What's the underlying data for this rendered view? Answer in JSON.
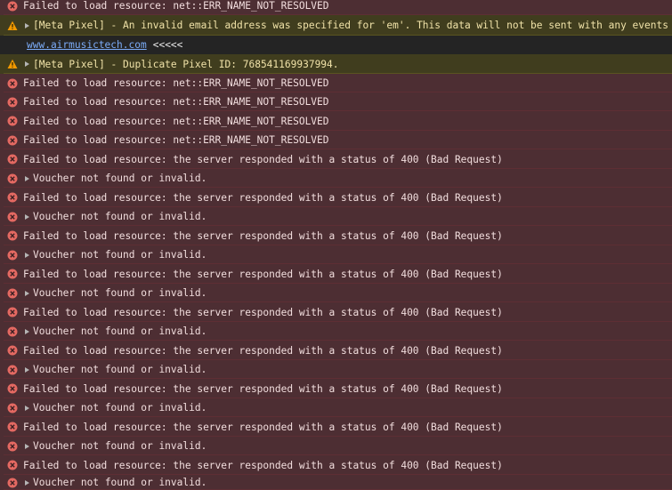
{
  "rows": [
    {
      "type": "error",
      "text": "Failed to load resource: net::ERR_NAME_NOT_RESOLVED",
      "expandable": false
    },
    {
      "type": "warning",
      "text": "[Meta Pixel] - An invalid email address was specified for 'em'. This data will not be sent with any events f",
      "expandable": true
    },
    {
      "type": "continuation",
      "link": "www.airmusictech.com",
      "tail": "<<<<<"
    },
    {
      "type": "warning",
      "text": "[Meta Pixel] - Duplicate Pixel ID: 768541169937994.",
      "expandable": true
    },
    {
      "type": "error",
      "text": "Failed to load resource: net::ERR_NAME_NOT_RESOLVED",
      "expandable": false
    },
    {
      "type": "error",
      "text": "Failed to load resource: net::ERR_NAME_NOT_RESOLVED",
      "expandable": false
    },
    {
      "type": "error",
      "text": "Failed to load resource: net::ERR_NAME_NOT_RESOLVED",
      "expandable": false
    },
    {
      "type": "error",
      "text": "Failed to load resource: net::ERR_NAME_NOT_RESOLVED",
      "expandable": false
    },
    {
      "type": "error",
      "text": "Failed to load resource: the server responded with a status of 400 (Bad Request)",
      "expandable": false
    },
    {
      "type": "error",
      "text": "Voucher not found or invalid.",
      "expandable": true
    },
    {
      "type": "error",
      "text": "Failed to load resource: the server responded with a status of 400 (Bad Request)",
      "expandable": false
    },
    {
      "type": "error",
      "text": "Voucher not found or invalid.",
      "expandable": true
    },
    {
      "type": "error",
      "text": "Failed to load resource: the server responded with a status of 400 (Bad Request)",
      "expandable": false
    },
    {
      "type": "error",
      "text": "Voucher not found or invalid.",
      "expandable": true
    },
    {
      "type": "error",
      "text": "Failed to load resource: the server responded with a status of 400 (Bad Request)",
      "expandable": false
    },
    {
      "type": "error",
      "text": "Voucher not found or invalid.",
      "expandable": true
    },
    {
      "type": "error",
      "text": "Failed to load resource: the server responded with a status of 400 (Bad Request)",
      "expandable": false
    },
    {
      "type": "error",
      "text": "Voucher not found or invalid.",
      "expandable": true
    },
    {
      "type": "error",
      "text": "Failed to load resource: the server responded with a status of 400 (Bad Request)",
      "expandable": false
    },
    {
      "type": "error",
      "text": "Voucher not found or invalid.",
      "expandable": true
    },
    {
      "type": "error",
      "text": "Failed to load resource: the server responded with a status of 400 (Bad Request)",
      "expandable": false
    },
    {
      "type": "error",
      "text": "Voucher not found or invalid.",
      "expandable": true
    },
    {
      "type": "error",
      "text": "Failed to load resource: the server responded with a status of 400 (Bad Request)",
      "expandable": false
    },
    {
      "type": "error",
      "text": "Voucher not found or invalid.",
      "expandable": true
    },
    {
      "type": "error",
      "text": "Failed to load resource: the server responded with a status of 400 (Bad Request)",
      "expandable": false
    },
    {
      "type": "error",
      "text": "Voucher not found or invalid.",
      "expandable": true
    }
  ],
  "icons": {
    "error": "error-circle-x-icon",
    "warning": "warning-triangle-icon",
    "toggle": "expand-triangle-icon"
  },
  "colors": {
    "error_bg": "#4d2e33",
    "warning_bg": "#403d1e",
    "error_icon": "#e46962",
    "warning_icon": "#f29900",
    "link": "#7cacf8"
  }
}
